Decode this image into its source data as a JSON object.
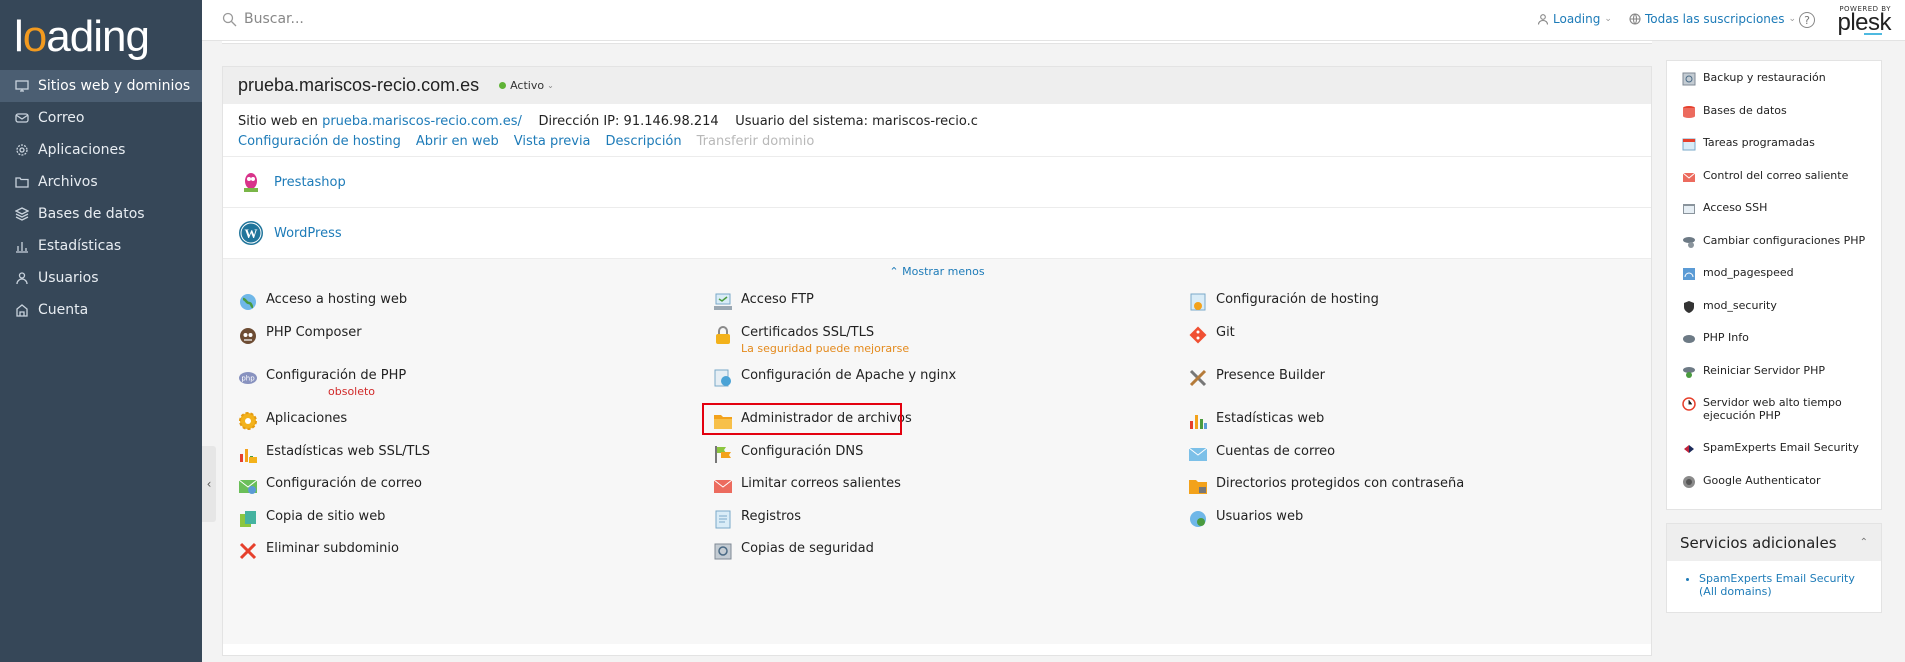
{
  "brand": {
    "logo_text": "loading",
    "powered_by": "POWERED BY",
    "plesk": "plesk"
  },
  "colors": {
    "sidebar": "#364758",
    "link": "#1d7bb8",
    "accent": "#f29a1f",
    "active_status": "#5fb336",
    "highlight": "#e3000f"
  },
  "sidebar": {
    "items": [
      {
        "label": "Sitios web y dominios",
        "icon": "monitor-icon"
      },
      {
        "label": "Correo",
        "icon": "mail-icon"
      },
      {
        "label": "Aplicaciones",
        "icon": "gear-icon"
      },
      {
        "label": "Archivos",
        "icon": "folder-icon"
      },
      {
        "label": "Bases de datos",
        "icon": "database-icon"
      },
      {
        "label": "Estadísticas",
        "icon": "bar-chart-icon"
      },
      {
        "label": "Usuarios",
        "icon": "user-icon"
      },
      {
        "label": "Cuenta",
        "icon": "account-icon"
      }
    ]
  },
  "header": {
    "search_placeholder": "Buscar...",
    "user_label": "Loading",
    "subscriptions_label": "Todas las suscripciones",
    "help": "?"
  },
  "domain": {
    "name": "prueba.mariscos-recio.com.es",
    "status": "Activo",
    "website_prefix": "Sitio web en",
    "website_link": "prueba.mariscos-recio.com.es/",
    "ip_label": "Dirección IP:",
    "ip_value": "91.146.98.214",
    "user_label": "Usuario del sistema:",
    "user_value": "mariscos-recio.c",
    "links": [
      "Configuración de hosting",
      "Abrir en web",
      "Vista previa",
      "Descripción",
      "Transferir dominio"
    ],
    "apps": [
      "Prestashop",
      "WordPress"
    ],
    "show_less": "Mostrar menos"
  },
  "tools": {
    "col1": [
      {
        "label": "Acceso a hosting web",
        "icon": "globe-icon"
      },
      {
        "label": "PHP Composer",
        "icon": "composer-icon"
      },
      {
        "label": "Configuración de PHP",
        "icon": "php-icon",
        "sub": "obsoleto"
      },
      {
        "label": "Aplicaciones",
        "icon": "gear-icon"
      },
      {
        "label": "Estadísticas web SSL/TLS",
        "icon": "chart-lock-icon"
      },
      {
        "label": "Configuración de correo",
        "icon": "mail-settings-icon"
      },
      {
        "label": "Copia de sitio web",
        "icon": "copy-icon"
      },
      {
        "label": "Eliminar subdominio",
        "icon": "delete-icon"
      }
    ],
    "col2": [
      {
        "label": "Acceso FTP",
        "icon": "ftp-icon"
      },
      {
        "label": "Certificados SSL/TLS",
        "icon": "lock-icon",
        "sub": "La seguridad puede mejorarse"
      },
      {
        "label": "Configuración de Apache y nginx",
        "icon": "server-icon"
      },
      {
        "label": "Administrador de archivos",
        "icon": "folder-icon"
      },
      {
        "label": "Configuración DNS",
        "icon": "dns-icon"
      },
      {
        "label": "Limitar correos salientes",
        "icon": "mail-limit-icon"
      },
      {
        "label": "Registros",
        "icon": "logs-icon"
      },
      {
        "label": "Copias de seguridad",
        "icon": "backup-icon"
      }
    ],
    "col3": [
      {
        "label": "Configuración de hosting",
        "icon": "hosting-icon"
      },
      {
        "label": "Git",
        "icon": "git-icon"
      },
      {
        "label": "Presence Builder",
        "icon": "tools-icon"
      },
      {
        "label": "Estadísticas web",
        "icon": "stats-icon"
      },
      {
        "label": "Cuentas de correo",
        "icon": "mail-icon"
      },
      {
        "label": "Directorios protegidos con contraseña",
        "icon": "protected-folder-icon"
      },
      {
        "label": "Usuarios web",
        "icon": "web-users-icon"
      }
    ]
  },
  "right_panel": {
    "items": [
      "Backup y restauración",
      "Bases de datos",
      "Tareas programadas",
      "Control del correo saliente",
      "Acceso SSH",
      "Cambiar configuraciones PHP",
      "mod_pagespeed",
      "mod_security",
      "PHP Info",
      "Reiniciar Servidor PHP",
      "Servidor web alto tiempo ejecución PHP",
      "SpamExperts Email Security",
      "Google Authenticator"
    ]
  },
  "extra_services": {
    "title": "Servicios adicionales",
    "items": [
      "SpamExperts Email Security (All domains)"
    ]
  }
}
